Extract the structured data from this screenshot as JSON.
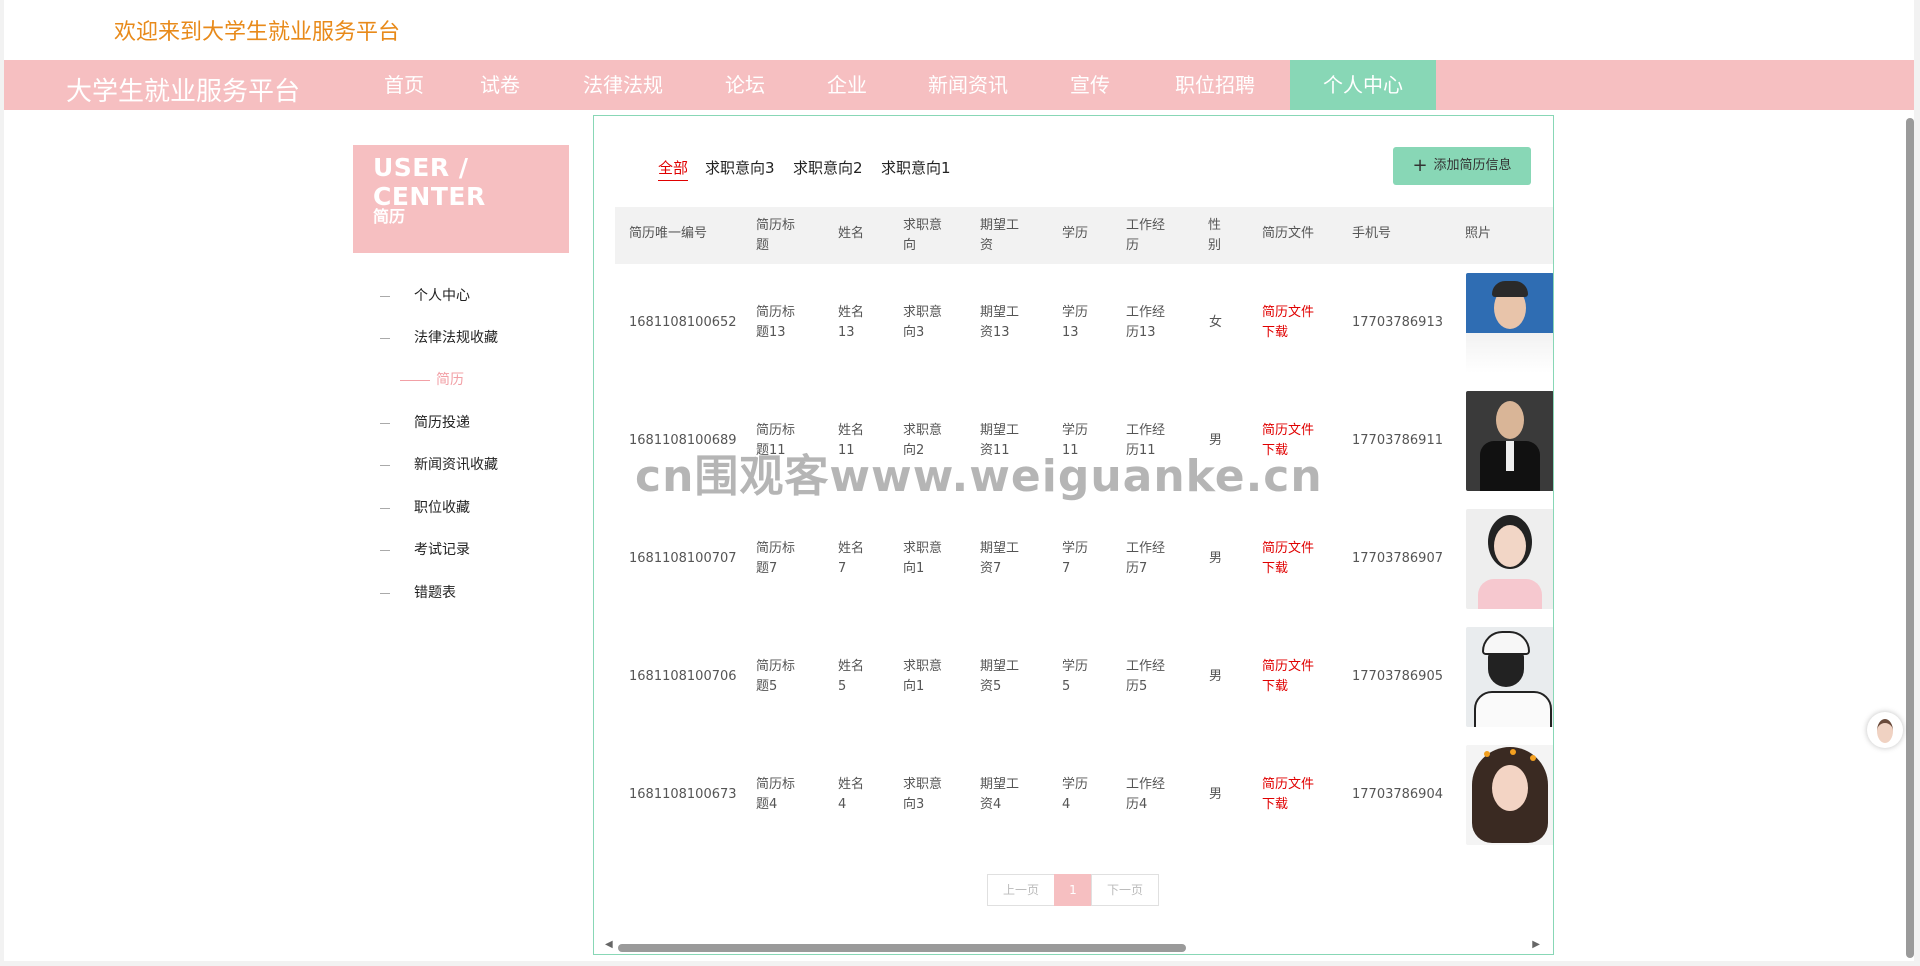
{
  "header": {
    "welcome": "欢迎来到大学生就业服务平台"
  },
  "nav": {
    "brand": "大学生就业服务平台",
    "items": [
      "首页",
      "试卷",
      "法律法规",
      "论坛",
      "企业",
      "新闻资讯",
      "宣传",
      "职位招聘",
      "个人中心"
    ],
    "active_index": 8
  },
  "sidebar": {
    "title": "USER / CENTER",
    "subtitle": "简历",
    "items": [
      "个人中心",
      "法律法规收藏",
      "简历",
      "简历投递",
      "新闻资讯收藏",
      "职位收藏",
      "考试记录",
      "错题表"
    ],
    "active_index": 2
  },
  "tabs": {
    "items": [
      "全部",
      "求职意向3",
      "求职意向2",
      "求职意向1"
    ],
    "active_index": 0
  },
  "add_button": {
    "label": "添加简历信息",
    "icon": "plus-icon"
  },
  "table": {
    "headers": [
      "简历唯一编号",
      "简历标题",
      "姓名",
      "求职意向",
      "期望工资",
      "学历",
      "工作经历",
      "性别",
      "简历文件",
      "手机号",
      "照片"
    ],
    "rows": [
      {
        "id": "1681108100652",
        "title": "简历标题13",
        "name": "姓名13",
        "intent": "求职意向3",
        "salary": "期望工资13",
        "edu": "学历13",
        "exp": "工作经历13",
        "gender": "女",
        "file": "简历文件下载",
        "phone": "17703786913"
      },
      {
        "id": "1681108100689",
        "title": "简历标题11",
        "name": "姓名11",
        "intent": "求职意向2",
        "salary": "期望工资11",
        "edu": "学历11",
        "exp": "工作经历11",
        "gender": "男",
        "file": "简历文件下载",
        "phone": "17703786911"
      },
      {
        "id": "1681108100707",
        "title": "简历标题7",
        "name": "姓名7",
        "intent": "求职意向1",
        "salary": "期望工资7",
        "edu": "学历7",
        "exp": "工作经历7",
        "gender": "男",
        "file": "简历文件下载",
        "phone": "17703786907"
      },
      {
        "id": "1681108100706",
        "title": "简历标题5",
        "name": "姓名5",
        "intent": "求职意向1",
        "salary": "期望工资5",
        "edu": "学历5",
        "exp": "工作经历5",
        "gender": "男",
        "file": "简历文件下载",
        "phone": "17703786905"
      },
      {
        "id": "1681108100673",
        "title": "简历标题4",
        "name": "姓名4",
        "intent": "求职意向3",
        "salary": "期望工资4",
        "edu": "学历4",
        "exp": "工作经历4",
        "gender": "男",
        "file": "简历文件下载",
        "phone": "17703786904"
      }
    ]
  },
  "pagination": {
    "prev": "上一页",
    "current": "1",
    "next": "下一页"
  },
  "watermark": "cn围观客www.weiguanke.cn",
  "colors": {
    "brand_pink": "#f6bfc1",
    "active_green": "#88d7b6",
    "welcome_orange": "#e88a1a",
    "link_red": "#e00000"
  }
}
